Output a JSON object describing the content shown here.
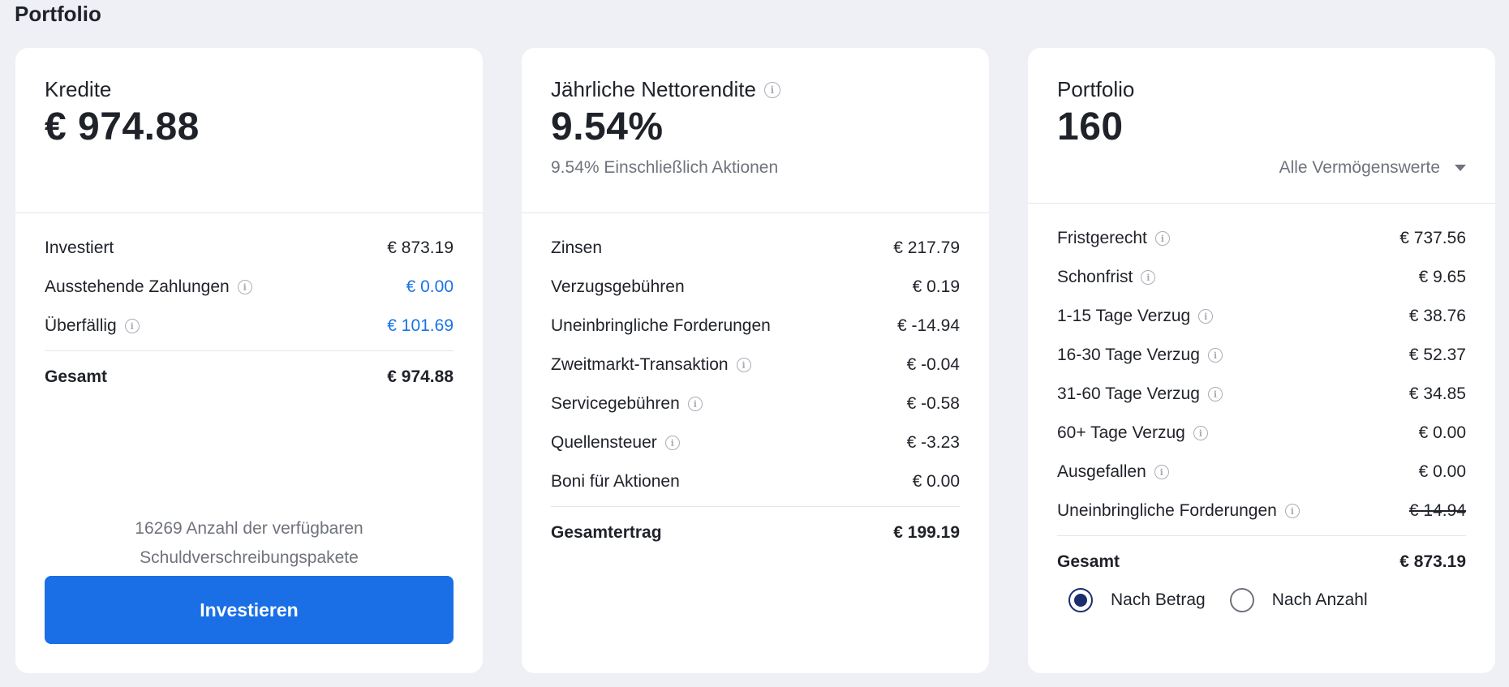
{
  "page": {
    "title": "Portfolio"
  },
  "loans": {
    "label": "Kredite",
    "value": "€ 974.88",
    "rows": [
      {
        "label": "Investiert",
        "value": "€ 873.19"
      },
      {
        "label": "Ausstehende Zahlungen",
        "value": "€ 0.00"
      },
      {
        "label": "Überfällig",
        "value": "€ 101.69"
      }
    ],
    "total": {
      "label": "Gesamt",
      "value": "€ 974.88"
    },
    "available_text": "16269 Anzahl der verfügbaren Schuldverschreibungspakete",
    "invest_button": "Investieren"
  },
  "return": {
    "label": "Jährliche Nettorendite",
    "value": "9.54%",
    "sub": "9.54% Einschließlich Aktionen",
    "rows": [
      {
        "label": "Zinsen",
        "value": "€ 217.79"
      },
      {
        "label": "Verzugsgebühren",
        "value": "€ 0.19"
      },
      {
        "label": "Uneinbringliche Forderungen",
        "value": "€ -14.94"
      },
      {
        "label": "Zweitmarkt-Transaktion",
        "value": "€ -0.04"
      },
      {
        "label": "Servicegebühren",
        "value": "€ -0.58"
      },
      {
        "label": "Quellensteuer",
        "value": "€ -3.23"
      },
      {
        "label": "Boni für Aktionen",
        "value": "€ 0.00"
      }
    ],
    "total": {
      "label": "Gesamtertrag",
      "value": "€ 199.19"
    }
  },
  "portfolio": {
    "label": "Portfolio",
    "value": "160",
    "filter": "Alle Vermögenswerte",
    "rows": [
      {
        "label": "Fristgerecht",
        "value": "€ 737.56"
      },
      {
        "label": "Schonfrist",
        "value": "€ 9.65"
      },
      {
        "label": "1-15 Tage Verzug",
        "value": "€ 38.76"
      },
      {
        "label": "16-30 Tage Verzug",
        "value": "€ 52.37"
      },
      {
        "label": "31-60 Tage Verzug",
        "value": "€ 34.85"
      },
      {
        "label": "60+ Tage Verzug",
        "value": "€ 0.00"
      },
      {
        "label": "Ausgefallen",
        "value": "€ 0.00"
      },
      {
        "label": "Uneinbringliche Forderungen",
        "value": "€ 14.94"
      }
    ],
    "total": {
      "label": "Gesamt",
      "value": "€ 873.19"
    },
    "radio_amount": "Nach Betrag",
    "radio_count": "Nach Anzahl"
  },
  "icons": {
    "info": "info-icon",
    "caret": "caret-down-icon"
  },
  "colors": {
    "accent": "#1a6fe6",
    "link": "#1a73e8",
    "radio": "#1a2e6e"
  }
}
